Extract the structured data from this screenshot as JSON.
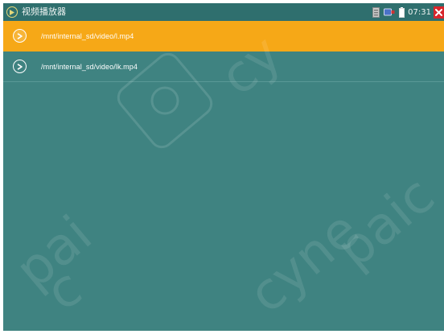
{
  "app": {
    "title": "视频播放器"
  },
  "status": {
    "time": "07:31"
  },
  "files": [
    {
      "path": "/mnt/internal_sd/video/l.mp4",
      "selected": true
    },
    {
      "path": "/mnt/internal_sd/video/lk.mp4",
      "selected": false
    }
  ],
  "colors": {
    "background": "#3f8381",
    "statusbar": "#2f6f6e",
    "selected_row": "#f6a817",
    "close_button": "#d8262c"
  },
  "icons": {
    "app": "video-player-icon",
    "row": "play-circle-icon",
    "status": [
      "sd-card-icon",
      "usb-icon",
      "battery-icon",
      "close-icon"
    ]
  }
}
